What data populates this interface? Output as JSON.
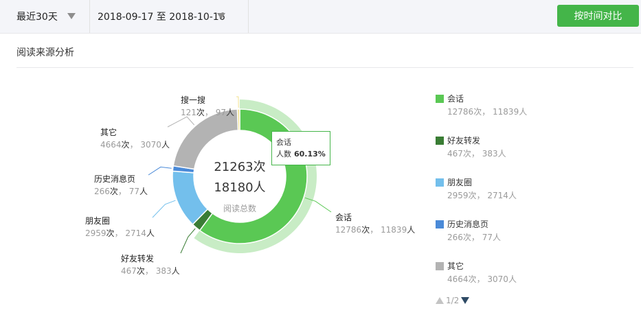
{
  "toolbar": {
    "range_label": "最近30天",
    "date_range": "2018-09-17 至 2018-10-16",
    "compare_label": "按时间对比"
  },
  "section": {
    "title": "阅读来源分析"
  },
  "tooltip": {
    "name": "会话",
    "label": "人数",
    "value": "60.13%"
  },
  "legend": {
    "items": [
      {
        "name": "会话",
        "stat_count": "12786",
        "stat_people": "11839"
      },
      {
        "name": "好友转发",
        "stat_count": "467",
        "stat_people": "383"
      },
      {
        "name": "朋友圈",
        "stat_count": "2959",
        "stat_people": "2714"
      },
      {
        "name": "历史消息页",
        "stat_count": "266",
        "stat_people": "77"
      },
      {
        "name": "其它",
        "stat_count": "4664",
        "stat_people": "3070"
      }
    ],
    "page": "1/2"
  },
  "chart_data": {
    "type": "pie",
    "center": {
      "total_reads": "21263次",
      "total_people": "18180人",
      "caption": "阅读总数"
    },
    "unit_count": "次",
    "unit_people": "人",
    "slices": [
      {
        "name": "会话",
        "count": 12786,
        "people": 11839,
        "color": "#5ac854"
      },
      {
        "name": "好友转发",
        "count": 467,
        "people": 383,
        "color": "#3a7d35"
      },
      {
        "name": "朋友圈",
        "count": 2959,
        "people": 2714,
        "color": "#73bfec"
      },
      {
        "name": "历史消息页",
        "count": 266,
        "people": 77,
        "color": "#4a8ad8"
      },
      {
        "name": "其它",
        "count": 4664,
        "people": 3070,
        "color": "#b3b3b3"
      },
      {
        "name": "搜一搜",
        "count": 121,
        "people": 97,
        "color": "#f3e28e"
      }
    ],
    "highlighted": "会话",
    "highlight_color": "#c8ecc5"
  }
}
